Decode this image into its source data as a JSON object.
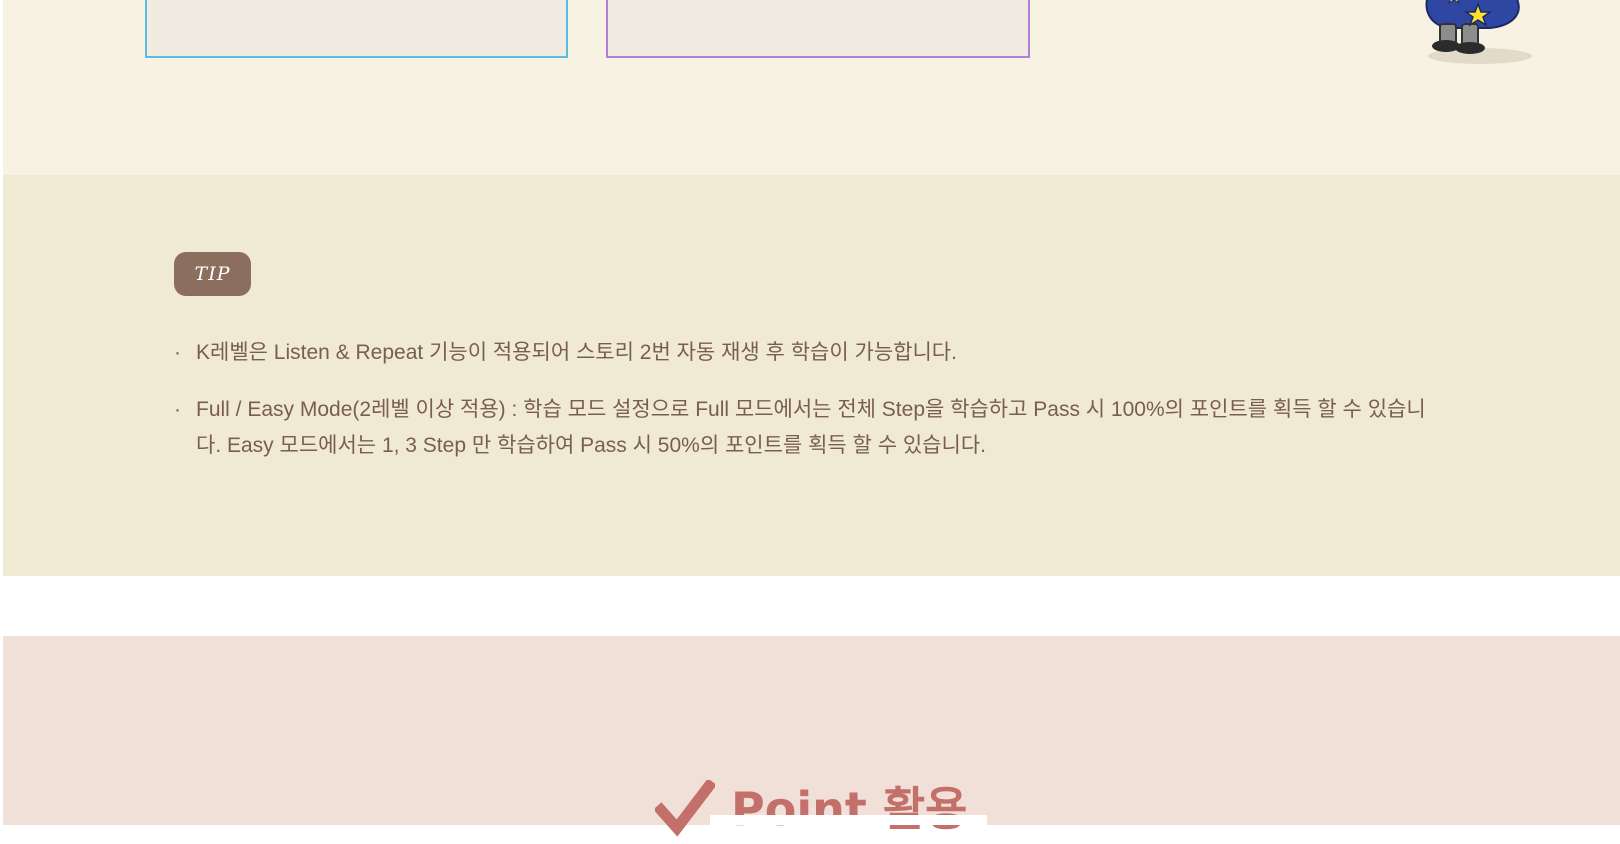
{
  "top": {
    "chip_colors": [
      "#cde8b5",
      "#f2d3b3",
      "#f0c4dc",
      "#c7dff5",
      "#bfe3f5"
    ]
  },
  "tip": {
    "badge": "TIP",
    "bullet": "·",
    "items": [
      "K레벨은 Listen & Repeat 기능이 적용되어 스토리 2번 자동 재생 후 학습이 가능합니다.",
      "Full / Easy Mode(2레벨 이상 적용) : 학습 모드 설정으로 Full 모드에서는 전체 Step을 학습하고 Pass 시 100%의 포인트를 획득 할 수 있습니다.  Easy 모드에서는 1, 3 Step 만 학습하여 Pass 시 50%의 포인트를 획득 할 수 있습니다."
    ]
  },
  "point": {
    "title": "Point 활용",
    "icon": "check-mark-icon",
    "accent": "#c4706a"
  },
  "colors": {
    "top_bg": "#f8f2e2",
    "tip_bg": "#f0ead3",
    "point_bg": "#f0e0d8",
    "badge_bg": "#8b6e5d",
    "text": "#7a5e4d",
    "card_blue_border": "#5bbbe3",
    "card_purple_border": "#b57ed6"
  }
}
